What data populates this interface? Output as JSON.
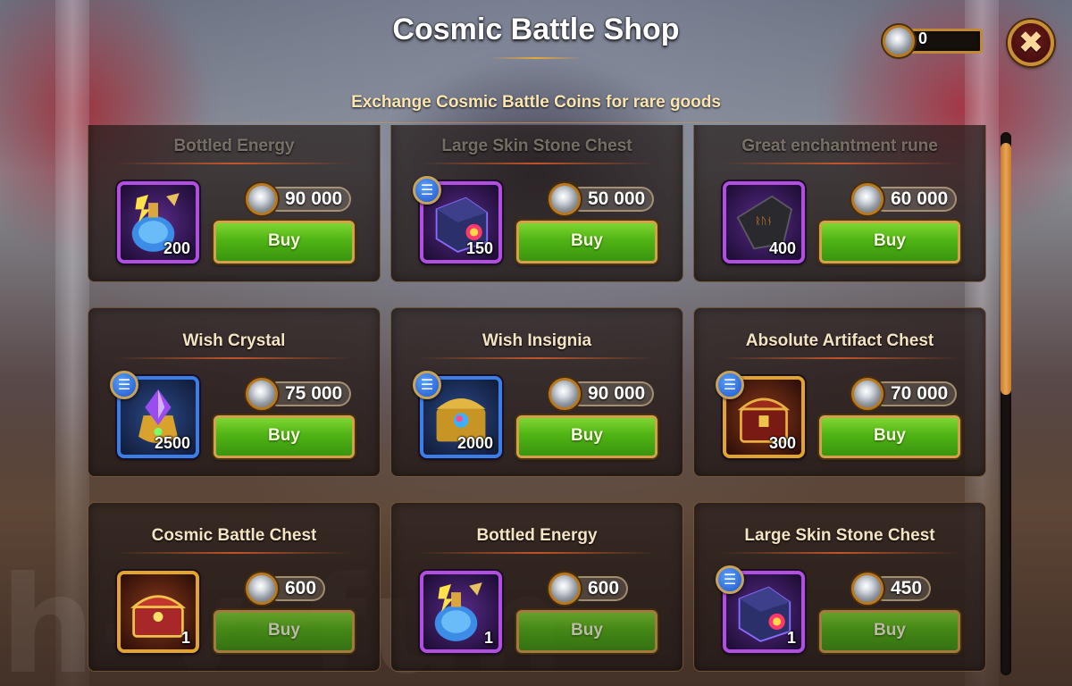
{
  "header": {
    "title": "Cosmic Battle Shop",
    "subtitle": "Exchange Cosmic Battle Coins for rare goods",
    "coin_balance": "0",
    "close_icon": "close-icon"
  },
  "watermark": "h-v-fun",
  "items": [
    {
      "title": "Bottled Energy",
      "price": "90 000",
      "qty": "200",
      "buy": "Buy",
      "icon": "bottled-energy-icon",
      "frame": "purple",
      "has_info": false
    },
    {
      "title": "Large Skin Stone Chest",
      "price": "50 000",
      "qty": "150",
      "buy": "Buy",
      "icon": "skin-stone-chest-icon",
      "frame": "purple",
      "has_info": true
    },
    {
      "title": "Great enchantment rune",
      "price": "60 000",
      "qty": "400",
      "buy": "Buy",
      "icon": "enchantment-rune-icon",
      "frame": "purple",
      "has_info": false
    },
    {
      "title": "Wish Crystal",
      "price": "75 000",
      "qty": "2500",
      "buy": "Buy",
      "icon": "wish-crystal-icon",
      "frame": "blue",
      "has_info": true
    },
    {
      "title": "Wish Insignia",
      "price": "90 000",
      "qty": "2000",
      "buy": "Buy",
      "icon": "wish-insignia-icon",
      "frame": "blue",
      "has_info": true
    },
    {
      "title": "Absolute Artifact Chest",
      "price": "70 000",
      "qty": "300",
      "buy": "Buy",
      "icon": "artifact-chest-icon",
      "frame": "gold",
      "has_info": true
    },
    {
      "title": "Cosmic Battle Chest",
      "price": "600",
      "qty": "1",
      "buy": "Buy",
      "icon": "cosmic-battle-chest-icon",
      "frame": "gold",
      "has_info": false
    },
    {
      "title": "Bottled Energy",
      "price": "600",
      "qty": "1",
      "buy": "Buy",
      "icon": "bottled-energy-icon",
      "frame": "purple",
      "has_info": false
    },
    {
      "title": "Large Skin Stone Chest",
      "price": "450",
      "qty": "1",
      "buy": "Buy",
      "icon": "skin-stone-chest-icon",
      "frame": "purple",
      "has_info": true
    }
  ],
  "colors": {
    "buy_green": "#4fb414",
    "gold_trim": "#d2a24a",
    "purple_frame": "#b14fe0",
    "blue_frame": "#3c7ee8",
    "gold_frame": "#e2a52c"
  }
}
